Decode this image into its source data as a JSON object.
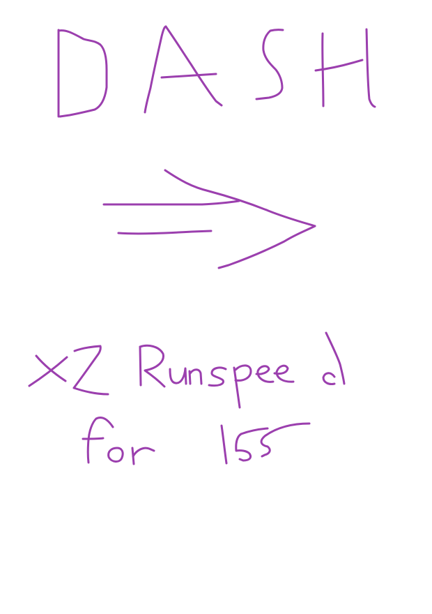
{
  "card": {
    "title": "DASH",
    "arrow_icon": "right-arrow-icon",
    "effect_line1": "x2 Runspeed",
    "effect_line2": "for 15s"
  },
  "colors": {
    "ink": "#9b3fae",
    "background": "#ffffff"
  }
}
